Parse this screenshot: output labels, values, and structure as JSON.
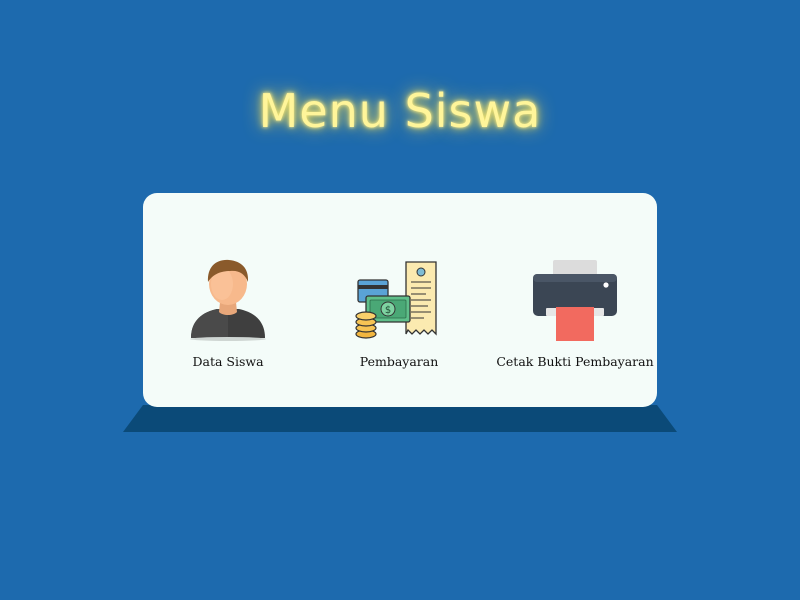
{
  "header": {
    "title": "Menu Siswa"
  },
  "menu": {
    "items": [
      {
        "label": "Data Siswa",
        "icon": "user-icon"
      },
      {
        "label": "Pembayaran",
        "icon": "payment-icon"
      },
      {
        "label": "Cetak Bukti Pembayaran",
        "icon": "printer-icon"
      }
    ]
  },
  "colors": {
    "background": "#1d6aae",
    "card": "#f4fcf9",
    "card_shadow": "#0b4a78",
    "title_glow": "#fff59a"
  }
}
